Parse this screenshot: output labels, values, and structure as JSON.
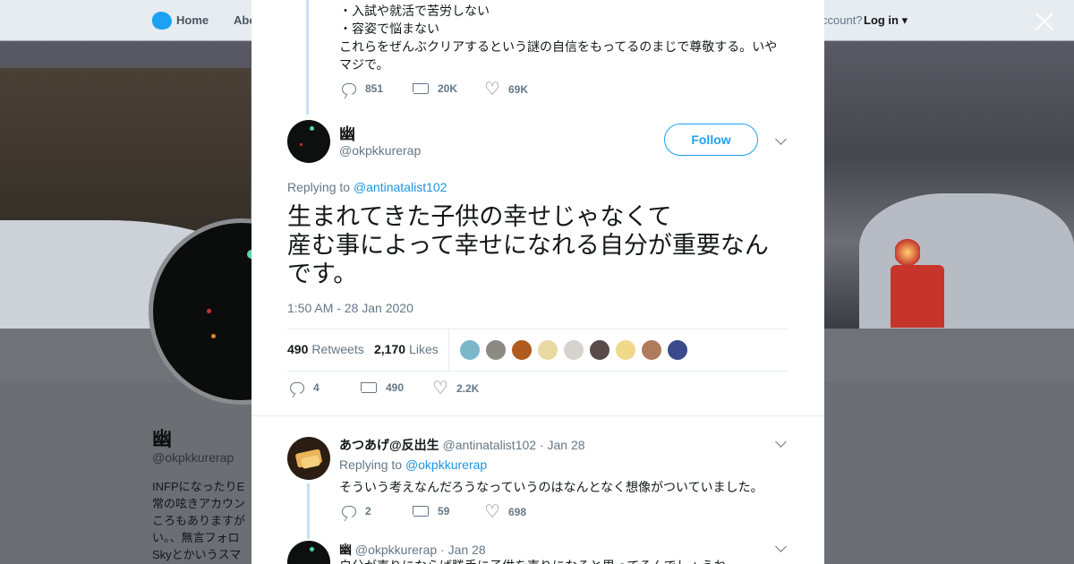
{
  "nav": {
    "home_label": "Home",
    "about_label": "Abo",
    "account_text": "ccount?",
    "login_label": "Log in"
  },
  "profile": {
    "name": "幽",
    "handle": "@okpkkurerap",
    "bio": "INFPになったりE 常の呟きアカウン ころもありますが い。、無言フォロ Skyとかいうスマ"
  },
  "prev_tweet": {
    "lines": [
      "・入試や就活で苦労しない",
      "・容姿で悩まない",
      "これらをぜんぶクリアするという謎の自信をもってるのまじで尊敬する。いや",
      "マジで。"
    ],
    "replies": "851",
    "retweets": "20K",
    "likes": "69K"
  },
  "main_tweet": {
    "name": "幽",
    "handle": "@okpkkurerap",
    "follow_label": "Follow",
    "replying_prefix": "Replying to",
    "replying_to": "@antinatalist102",
    "text_line1": "生まれてきた子供の幸せじゃなくて",
    "text_line2": "産む事によって幸せになれる自分が重要なん",
    "text_line3": "です。",
    "timestamp": "1:50 AM - 28 Jan 2020",
    "retweet_count": "490",
    "retweet_label": "Retweets",
    "like_count": "2,170",
    "like_label": "Likes",
    "replies": "4",
    "retweets": "490",
    "likes": "2.2K"
  },
  "liker_colors": [
    "#7ab8c9",
    "#8d8a86",
    "#b05a1e",
    "#e9d9a2",
    "#d6d3cf",
    "#5a4a4a",
    "#f0d98a",
    "#b07a5c",
    "#3a4a8a"
  ],
  "reply1": {
    "name": "あつあげ@反出生",
    "handle": "@antinatalist102",
    "date": "· Jan 28",
    "replying_prefix": "Replying to",
    "replying_to": "@okpkkurerap",
    "text": "そういう考えなんだろうなっていうのはなんとなく想像がついていました。",
    "replies": "2",
    "retweets": "59",
    "likes": "698"
  },
  "reply2": {
    "name": "幽",
    "handle": "@okpkkurerap",
    "date": "· Jan 28",
    "text": "自分が売りにならば勝手に子供を売りになると思ってるんでしょうね"
  }
}
